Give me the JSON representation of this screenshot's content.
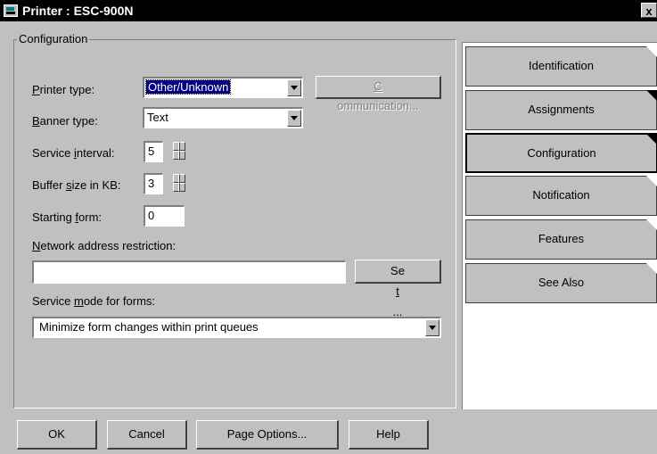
{
  "window": {
    "title": "Printer : ESC-900N",
    "close_glyph": "x"
  },
  "group": {
    "label": "Configuration"
  },
  "fields": {
    "printer_type": {
      "label_pre": "",
      "label_u": "P",
      "label_post": "rinter type:",
      "value": "Other/Unknown"
    },
    "banner_type": {
      "label_pre": "",
      "label_u": "B",
      "label_post": "anner type:",
      "value": "Text"
    },
    "service_interval": {
      "label_pre": "Service ",
      "label_u": "i",
      "label_post": "nterval:",
      "value": "5"
    },
    "buffer_size": {
      "label_pre": "Buffer ",
      "label_u": "s",
      "label_post": "ize in KB:",
      "value": "3"
    },
    "starting_form": {
      "label_pre": "Starting ",
      "label_u": "f",
      "label_post": "orm:",
      "value": "0"
    },
    "network_restriction": {
      "label_pre": "",
      "label_u": "N",
      "label_post": "etwork address restriction:",
      "value": ""
    },
    "service_mode": {
      "label_pre": "Service ",
      "label_u": "m",
      "label_post": "ode for forms:",
      "value": "Minimize form changes within print queues"
    }
  },
  "buttons": {
    "communication": {
      "pre": "",
      "u": "C",
      "post": "ommunication..."
    },
    "set": {
      "pre": "Se",
      "u": "t",
      "post": "..."
    },
    "ok": "OK",
    "cancel": "Cancel",
    "page_options": "Page Options...",
    "help": "Help"
  },
  "tabs": [
    {
      "label": "Identification"
    },
    {
      "label": "Assignments"
    },
    {
      "label": "Configuration"
    },
    {
      "label": "Notification"
    },
    {
      "label": "Features"
    },
    {
      "label": "See Also"
    }
  ],
  "icons": {
    "app": "printer-window-icon",
    "close": "close-icon",
    "dropdown": "chevron-down-icon",
    "spinner": "spinner-arrows-icon"
  }
}
